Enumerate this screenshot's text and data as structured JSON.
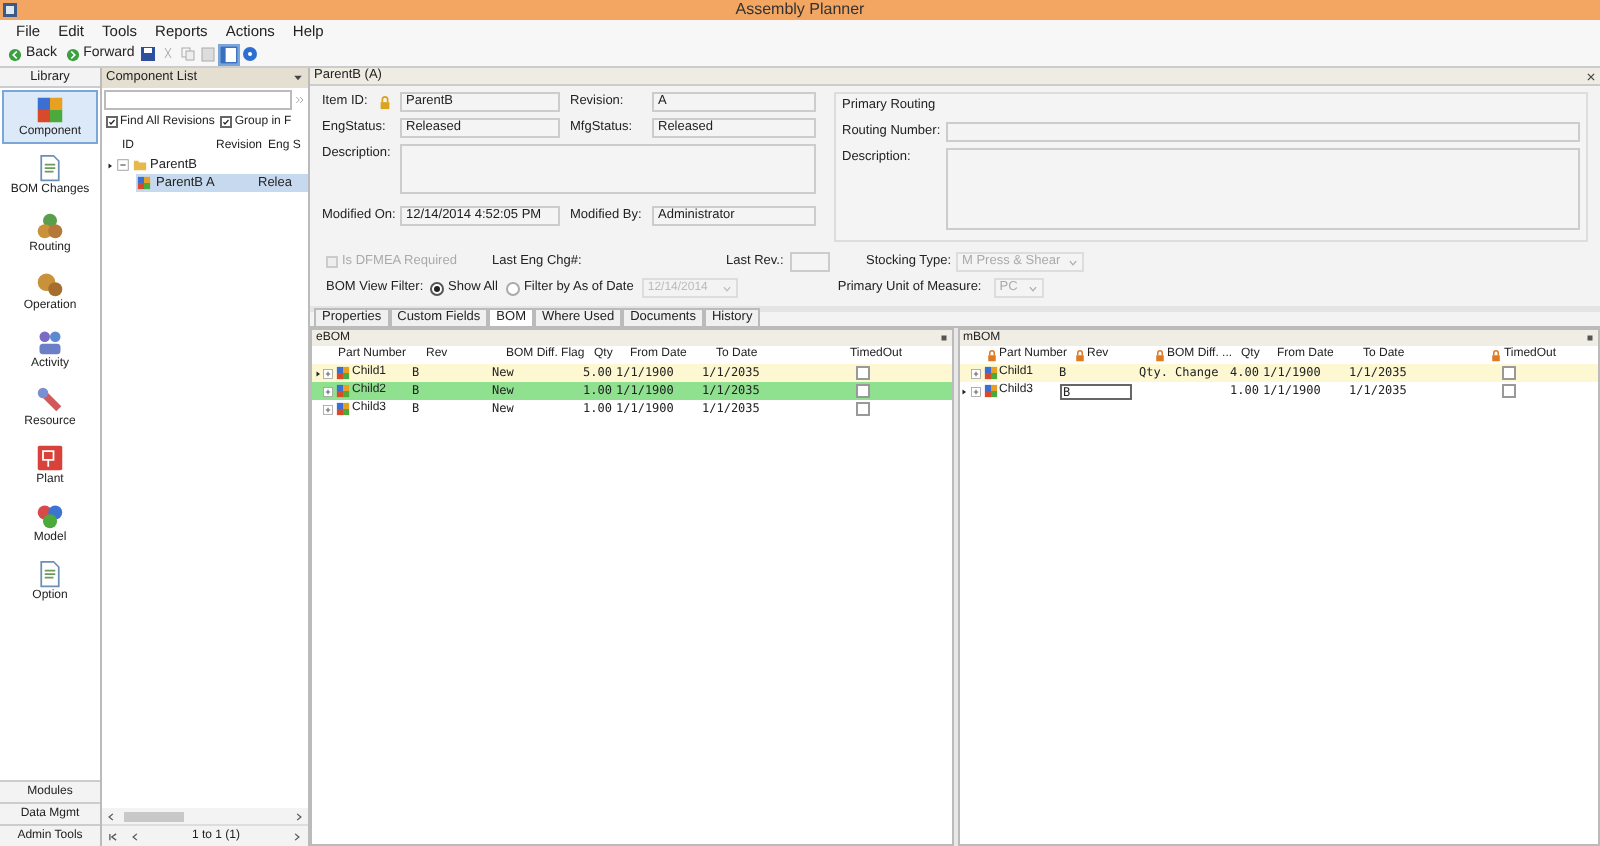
{
  "window": {
    "title": "Assembly Planner"
  },
  "menu": [
    {
      "label": "File"
    },
    {
      "label": "Edit"
    },
    {
      "label": "Tools"
    },
    {
      "label": "Reports"
    },
    {
      "label": "Actions"
    },
    {
      "label": "Help"
    }
  ],
  "toolbar": [
    {
      "kind": "back",
      "label": "Back"
    },
    {
      "kind": "forward",
      "label": "Forward"
    },
    {
      "kind": "save"
    },
    {
      "kind": "cut"
    },
    {
      "kind": "copy"
    },
    {
      "kind": "paste"
    },
    {
      "kind": "panel",
      "selected": true
    },
    {
      "kind": "help"
    }
  ],
  "library": {
    "title": "Library",
    "items": [
      {
        "label": "Component",
        "kind": "component",
        "selected": true
      },
      {
        "label": "BOM Changes",
        "kind": "doc",
        "selected": false
      },
      {
        "label": "Routing",
        "kind": "routing",
        "selected": false
      },
      {
        "label": "Operation",
        "kind": "operation",
        "selected": false
      },
      {
        "label": "Activity",
        "kind": "activity",
        "selected": false
      },
      {
        "label": "Resource",
        "kind": "resource",
        "selected": false
      },
      {
        "label": "Plant",
        "kind": "plant",
        "selected": false
      },
      {
        "label": "Model",
        "kind": "model",
        "selected": false
      },
      {
        "label": "Option",
        "kind": "doc",
        "selected": false
      }
    ],
    "bottom": [
      {
        "label": "Modules"
      },
      {
        "label": "Data Mgmt"
      },
      {
        "label": "Admin Tools"
      }
    ]
  },
  "component_list": {
    "title": "Component List",
    "options": [
      {
        "label": "Find All Revisions",
        "checked": true
      },
      {
        "label": "Group in F",
        "checked": true
      }
    ],
    "columns": [
      "ID",
      "Revision",
      "Eng S"
    ],
    "tree": [
      {
        "id": "ParentB",
        "expanded": true,
        "selected": false,
        "children": [
          {
            "id": "ParentB",
            "revision": "A",
            "eng_status": "Relea",
            "selected": true
          }
        ]
      }
    ],
    "pager": "1 to 1 (1)"
  },
  "detail": {
    "title": "ParentB (A)",
    "item_id": {
      "label": "Item ID:",
      "value": "ParentB"
    },
    "revision": {
      "label": "Revision:",
      "value": "A"
    },
    "eng_status": {
      "label": "EngStatus:",
      "value": "Released"
    },
    "mfg_status": {
      "label": "MfgStatus:",
      "value": "Released"
    },
    "description": {
      "label": "Description:"
    },
    "modified_on": {
      "label": "Modified On:",
      "value": "12/14/2014 4:52:05 PM"
    },
    "modified_by": {
      "label": "Modified By:",
      "value": "Administrator"
    },
    "routing": {
      "title": "Primary Routing",
      "number_label": "Routing Number:",
      "description_label": "Description:"
    },
    "dfmea": {
      "label": "Is DFMEA Required",
      "checked": false,
      "disabled": true
    },
    "last_eng_chg": {
      "label": "Last Eng Chg#:"
    },
    "last_rev": {
      "label": "Last Rev.:"
    },
    "stocking_type": {
      "label": "Stocking Type:",
      "value": "M Press & Shear",
      "disabled": true
    },
    "bom_view_filter": {
      "label": "BOM View Filter:",
      "options": [
        {
          "label": "Show All",
          "selected": true
        },
        {
          "label": "Filter by As of Date",
          "selected": false
        }
      ],
      "date": "12/14/2014"
    },
    "unit_of_measure": {
      "label": "Primary Unit of Measure:",
      "value": "PC",
      "disabled": true
    },
    "tabs": [
      {
        "label": "Properties",
        "selected": false
      },
      {
        "label": "Custom Fields",
        "selected": false
      },
      {
        "label": "BOM",
        "selected": true
      },
      {
        "label": "Where Used",
        "selected": false
      },
      {
        "label": "Documents",
        "selected": false
      },
      {
        "label": "History",
        "selected": false
      }
    ]
  },
  "ebom": {
    "title": "eBOM",
    "columns": [
      {
        "label": "Part Number",
        "locked": false
      },
      {
        "label": "Rev",
        "locked": false
      },
      {
        "label": "BOM Diff. Flag",
        "locked": false
      },
      {
        "label": "Qty",
        "locked": false
      },
      {
        "label": "From Date",
        "locked": false
      },
      {
        "label": "To Date",
        "locked": false
      },
      {
        "label": "TimedOut",
        "locked": false
      }
    ],
    "rows": [
      {
        "part": "Child1",
        "rev": "B",
        "flag": "New",
        "qty": "5.00",
        "from": "1/1/1900",
        "to": "1/1/2035",
        "timed_out": false,
        "current": true,
        "selected": false,
        "editing": false
      },
      {
        "part": "Child2",
        "rev": "B",
        "flag": "New",
        "qty": "1.00",
        "from": "1/1/1900",
        "to": "1/1/2035",
        "timed_out": false,
        "current": false,
        "selected": true,
        "editing": false
      },
      {
        "part": "Child3",
        "rev": "B",
        "flag": "New",
        "qty": "1.00",
        "from": "1/1/1900",
        "to": "1/1/2035",
        "timed_out": false,
        "current": false,
        "selected": false,
        "editing": false
      }
    ]
  },
  "mbom": {
    "title": "mBOM",
    "columns": [
      {
        "label": "Part Number",
        "locked": true
      },
      {
        "label": "Rev",
        "locked": true
      },
      {
        "label": "BOM Diff. ...",
        "locked": true
      },
      {
        "label": "Qty",
        "locked": false
      },
      {
        "label": "From Date",
        "locked": false
      },
      {
        "label": "To Date",
        "locked": false
      },
      {
        "label": "TimedOut",
        "locked": true
      }
    ],
    "rows": [
      {
        "part": "Child1",
        "rev": "B",
        "flag": "Qty. Change",
        "qty": "4.00",
        "from": "1/1/1900",
        "to": "1/1/2035",
        "timed_out": false,
        "current": false,
        "selected": false,
        "editing": false,
        "highlight": true
      },
      {
        "part": "Child3",
        "rev": "B",
        "qty": "1.00",
        "from": "1/1/1900",
        "to": "1/1/2035",
        "timed_out": false,
        "current": true,
        "selected": false,
        "editing": true
      }
    ]
  }
}
